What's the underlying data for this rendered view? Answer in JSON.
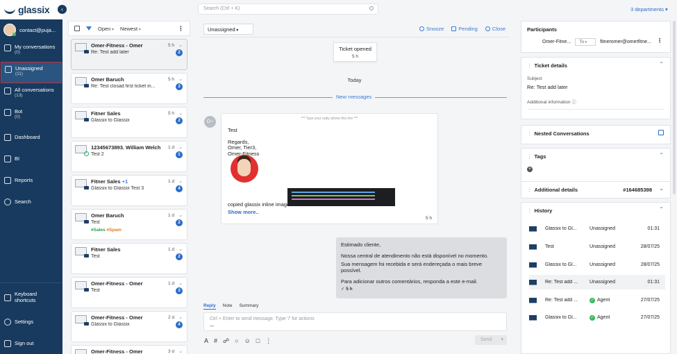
{
  "brand": {
    "name": "glassix"
  },
  "user": {
    "email": "contact@puja..."
  },
  "nav": [
    {
      "label": "My conversations",
      "count": "(0)"
    },
    {
      "label": "Unassigned",
      "count": "(11)"
    },
    {
      "label": "All conversations",
      "count": "(13)"
    },
    {
      "label": "Bot",
      "count": "(0)"
    },
    {
      "label": "Dashboard"
    },
    {
      "label": "BI"
    },
    {
      "label": "Reports"
    },
    {
      "label": "Search"
    }
  ],
  "nav_bottom": [
    {
      "label": "Keyboard shortcuts"
    },
    {
      "label": "Settings"
    },
    {
      "label": "Sign out"
    }
  ],
  "search": {
    "placeholder": "Search (Ctrl + K)"
  },
  "departments": "3 departments",
  "list": {
    "status_filter": "Open",
    "sort": "Newest",
    "tickets": [
      {
        "name": "Omer-Fitness - Omer",
        "time": "5 h",
        "subject": "Re: Test add later",
        "badge": "2"
      },
      {
        "name": "Omer Baruch",
        "time": "5 h",
        "subject": "Re: Test closad first ticket in...",
        "badge": "3"
      },
      {
        "name": "Fitner Sales",
        "time": "5 h",
        "subject": "Glassix to Glassix",
        "badge": "2"
      },
      {
        "name": "12345673893. William Welch",
        "time": "1 d",
        "subject": "Test 2",
        "badge": "1"
      },
      {
        "name": "Fitner Sales",
        "extra": "+1",
        "time": "1 d",
        "subject": "Glassix to Glassix Test 3",
        "badge": "4"
      },
      {
        "name": "Omer Baruch",
        "time": "1 d",
        "subject": "Test",
        "badge": "2",
        "tag1": "#Sales",
        "tag2": "#Spam"
      },
      {
        "name": "Fitner Sales",
        "time": "1 d",
        "subject": "Test",
        "badge": "2"
      },
      {
        "name": "Omer-Fitness - Omer",
        "time": "1 d",
        "subject": "Test",
        "badge": "3"
      },
      {
        "name": "Omer-Fitness - Omer",
        "time": "2 d",
        "subject": "Glassix to Glassix",
        "badge": "4"
      },
      {
        "name": "Omer-Fitness - Omer",
        "time": "3 d"
      }
    ]
  },
  "conversation": {
    "assignee": "Unassigned",
    "actions": {
      "snooze": "Snooze",
      "pending": "Pending",
      "close": "Close"
    },
    "system_event": {
      "label": "Ticket opened",
      "time": "5 h"
    },
    "day_divider": "Today",
    "new_messages": "New messages",
    "customer_initials": "O~",
    "incoming": {
      "hint": "*** Type your reply above this line ***",
      "lines": [
        "Test",
        "",
        "Regards,",
        "Omer, Tier3,",
        "Omer-Fitness"
      ],
      "inline_text": "copied glassix inline images",
      "show_more": "Show more..",
      "time": "5 h"
    },
    "outgoing": {
      "line1": "Estimado cliente,",
      "line2": "Nossa central de atendimento não está disponível no momento.",
      "line3": "Sua mensagem foi recebida e será endereçada o mais breve possível.",
      "line4": "Para adicionar outros comentários, responda a este e-mail.",
      "time": "5 h"
    },
    "reply_tabs": [
      "Reply",
      "Note",
      "Summary"
    ],
    "composer_placeholder": "Ctrl + Enter to send message. Type '/' for actions",
    "send_label": "Send"
  },
  "details": {
    "participants_title": "Participants",
    "participant_name": "Omer-Fitne...",
    "participant_field": "To",
    "participant_email": "fitneromer@omerfitne...",
    "ticket_details_title": "Ticket details",
    "subject_label": "Subject",
    "subject_value": "Re: Test add later",
    "additional_info_label": "Additional information",
    "nested_title": "Nested Conversations",
    "tags_title": "Tags",
    "additional_details_title": "Additional details",
    "ticket_id": "#164685398",
    "history_title": "History",
    "history": [
      {
        "subject": "Glassix to Gl...",
        "assignee": "Unassigned",
        "time": "01:31",
        "agent": false
      },
      {
        "subject": "Test",
        "assignee": "Unassigned",
        "time": "28/07/25",
        "agent": false
      },
      {
        "subject": "Glassix to Gl...",
        "assignee": "Unassigned",
        "time": "28/07/25",
        "agent": false
      },
      {
        "subject": "Re: Test add ...",
        "assignee": "Unassigned",
        "time": "01:31",
        "agent": false
      },
      {
        "subject": "Re: Test add ...",
        "assignee": "Agent",
        "time": "27/07/25",
        "agent": true
      },
      {
        "subject": "Glassix to Gl...",
        "assignee": "Agent",
        "time": "27/07/25",
        "agent": true
      }
    ]
  },
  "colors": {
    "sidebar": "#173a5e",
    "accent": "#2b6cc9",
    "highlight": "#e0242f"
  }
}
